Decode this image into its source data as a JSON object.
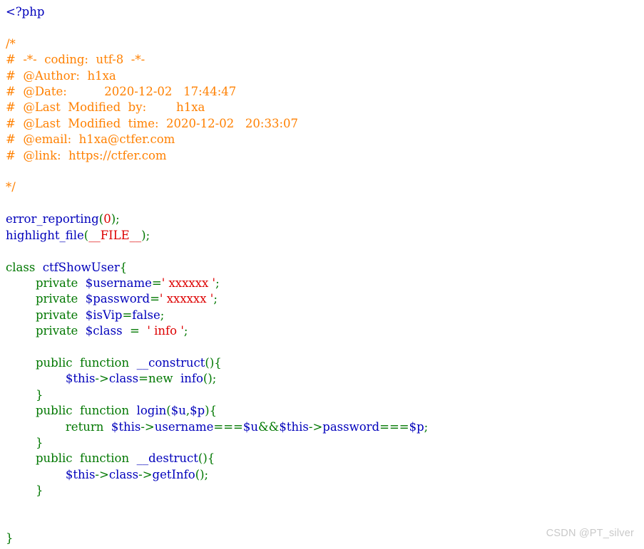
{
  "document": {
    "kind": "php-source-highlight",
    "language": "PHP",
    "background_color": "#ffffff",
    "palette": {
      "default": "#0000BB",
      "keyword": "#007700",
      "string": "#DD0000",
      "comment": "#FF8000",
      "html": "#000000"
    },
    "lines": [
      [
        {
          "t": "<?php",
          "c": "default"
        }
      ],
      [],
      [
        {
          "t": "/*",
          "c": "comment"
        }
      ],
      [
        {
          "t": "#  -*-  coding:  utf-8  -*-",
          "c": "comment"
        }
      ],
      [
        {
          "t": "#  @Author:  h1xa",
          "c": "comment"
        }
      ],
      [
        {
          "t": "#  @Date:          2020-12-02   17:44:47",
          "c": "comment"
        }
      ],
      [
        {
          "t": "#  @Last  Modified  by:        h1xa",
          "c": "comment"
        }
      ],
      [
        {
          "t": "#  @Last  Modified  time:  2020-12-02   20:33:07",
          "c": "comment"
        }
      ],
      [
        {
          "t": "#  @email:  h1xa@ctfer.com",
          "c": "comment"
        }
      ],
      [
        {
          "t": "#  @link:  https://ctfer.com",
          "c": "comment"
        }
      ],
      [],
      [
        {
          "t": "*/",
          "c": "comment"
        }
      ],
      [],
      [
        {
          "t": "error_reporting",
          "c": "default"
        },
        {
          "t": "(",
          "c": "keyword"
        },
        {
          "t": "0",
          "c": "string"
        },
        {
          "t": ");",
          "c": "keyword"
        }
      ],
      [
        {
          "t": "highlight_file",
          "c": "default"
        },
        {
          "t": "(",
          "c": "keyword"
        },
        {
          "t": "__FILE__",
          "c": "string"
        },
        {
          "t": ");",
          "c": "keyword"
        }
      ],
      [],
      [
        {
          "t": "class",
          "c": "keyword"
        },
        {
          "t": "  ",
          "c": "keyword"
        },
        {
          "t": "ctfShowUser",
          "c": "default"
        },
        {
          "t": "{",
          "c": "keyword"
        }
      ],
      [
        {
          "t": "        ",
          "c": "keyword"
        },
        {
          "t": "private",
          "c": "keyword"
        },
        {
          "t": "  ",
          "c": "keyword"
        },
        {
          "t": "$username",
          "c": "default"
        },
        {
          "t": "=",
          "c": "keyword"
        },
        {
          "t": "' xxxxxx '",
          "c": "string"
        },
        {
          "t": ";",
          "c": "keyword"
        }
      ],
      [
        {
          "t": "        ",
          "c": "keyword"
        },
        {
          "t": "private",
          "c": "keyword"
        },
        {
          "t": "  ",
          "c": "keyword"
        },
        {
          "t": "$password",
          "c": "default"
        },
        {
          "t": "=",
          "c": "keyword"
        },
        {
          "t": "' xxxxxx '",
          "c": "string"
        },
        {
          "t": ";",
          "c": "keyword"
        }
      ],
      [
        {
          "t": "        ",
          "c": "keyword"
        },
        {
          "t": "private",
          "c": "keyword"
        },
        {
          "t": "  ",
          "c": "keyword"
        },
        {
          "t": "$isVip",
          "c": "default"
        },
        {
          "t": "=",
          "c": "keyword"
        },
        {
          "t": "false",
          "c": "default"
        },
        {
          "t": ";",
          "c": "keyword"
        }
      ],
      [
        {
          "t": "        ",
          "c": "keyword"
        },
        {
          "t": "private",
          "c": "keyword"
        },
        {
          "t": "  ",
          "c": "keyword"
        },
        {
          "t": "$class",
          "c": "default"
        },
        {
          "t": "  =  ",
          "c": "keyword"
        },
        {
          "t": "' info '",
          "c": "string"
        },
        {
          "t": ";",
          "c": "keyword"
        }
      ],
      [],
      [
        {
          "t": "        ",
          "c": "keyword"
        },
        {
          "t": "public",
          "c": "keyword"
        },
        {
          "t": "  ",
          "c": "keyword"
        },
        {
          "t": "function",
          "c": "keyword"
        },
        {
          "t": "  ",
          "c": "keyword"
        },
        {
          "t": "__construct",
          "c": "default"
        },
        {
          "t": "(){",
          "c": "keyword"
        }
      ],
      [
        {
          "t": "                ",
          "c": "keyword"
        },
        {
          "t": "$this",
          "c": "default"
        },
        {
          "t": "->",
          "c": "keyword"
        },
        {
          "t": "class",
          "c": "default"
        },
        {
          "t": "=",
          "c": "keyword"
        },
        {
          "t": "new",
          "c": "keyword"
        },
        {
          "t": "  ",
          "c": "keyword"
        },
        {
          "t": "info",
          "c": "default"
        },
        {
          "t": "();",
          "c": "keyword"
        }
      ],
      [
        {
          "t": "        ",
          "c": "keyword"
        },
        {
          "t": "}",
          "c": "keyword"
        }
      ],
      [
        {
          "t": "        ",
          "c": "keyword"
        },
        {
          "t": "public",
          "c": "keyword"
        },
        {
          "t": "  ",
          "c": "keyword"
        },
        {
          "t": "function",
          "c": "keyword"
        },
        {
          "t": "  ",
          "c": "keyword"
        },
        {
          "t": "login",
          "c": "default"
        },
        {
          "t": "(",
          "c": "keyword"
        },
        {
          "t": "$u",
          "c": "default"
        },
        {
          "t": ",",
          "c": "keyword"
        },
        {
          "t": "$p",
          "c": "default"
        },
        {
          "t": "){",
          "c": "keyword"
        }
      ],
      [
        {
          "t": "                ",
          "c": "keyword"
        },
        {
          "t": "return",
          "c": "keyword"
        },
        {
          "t": "  ",
          "c": "keyword"
        },
        {
          "t": "$this",
          "c": "default"
        },
        {
          "t": "->",
          "c": "keyword"
        },
        {
          "t": "username",
          "c": "default"
        },
        {
          "t": "===",
          "c": "keyword"
        },
        {
          "t": "$u",
          "c": "default"
        },
        {
          "t": "&&",
          "c": "keyword"
        },
        {
          "t": "$this",
          "c": "default"
        },
        {
          "t": "->",
          "c": "keyword"
        },
        {
          "t": "password",
          "c": "default"
        },
        {
          "t": "===",
          "c": "keyword"
        },
        {
          "t": "$p",
          "c": "default"
        },
        {
          "t": ";",
          "c": "keyword"
        }
      ],
      [
        {
          "t": "        ",
          "c": "keyword"
        },
        {
          "t": "}",
          "c": "keyword"
        }
      ],
      [
        {
          "t": "        ",
          "c": "keyword"
        },
        {
          "t": "public",
          "c": "keyword"
        },
        {
          "t": "  ",
          "c": "keyword"
        },
        {
          "t": "function",
          "c": "keyword"
        },
        {
          "t": "  ",
          "c": "keyword"
        },
        {
          "t": "__destruct",
          "c": "default"
        },
        {
          "t": "(){",
          "c": "keyword"
        }
      ],
      [
        {
          "t": "                ",
          "c": "keyword"
        },
        {
          "t": "$this",
          "c": "default"
        },
        {
          "t": "->",
          "c": "keyword"
        },
        {
          "t": "class",
          "c": "default"
        },
        {
          "t": "->",
          "c": "keyword"
        },
        {
          "t": "getInfo",
          "c": "default"
        },
        {
          "t": "();",
          "c": "keyword"
        }
      ],
      [
        {
          "t": "        ",
          "c": "keyword"
        },
        {
          "t": "}",
          "c": "keyword"
        }
      ],
      [],
      [],
      [
        {
          "t": "}",
          "c": "keyword"
        }
      ]
    ]
  },
  "watermark": {
    "text": "CSDN @PT_silver",
    "color": "#c9c9c9"
  }
}
